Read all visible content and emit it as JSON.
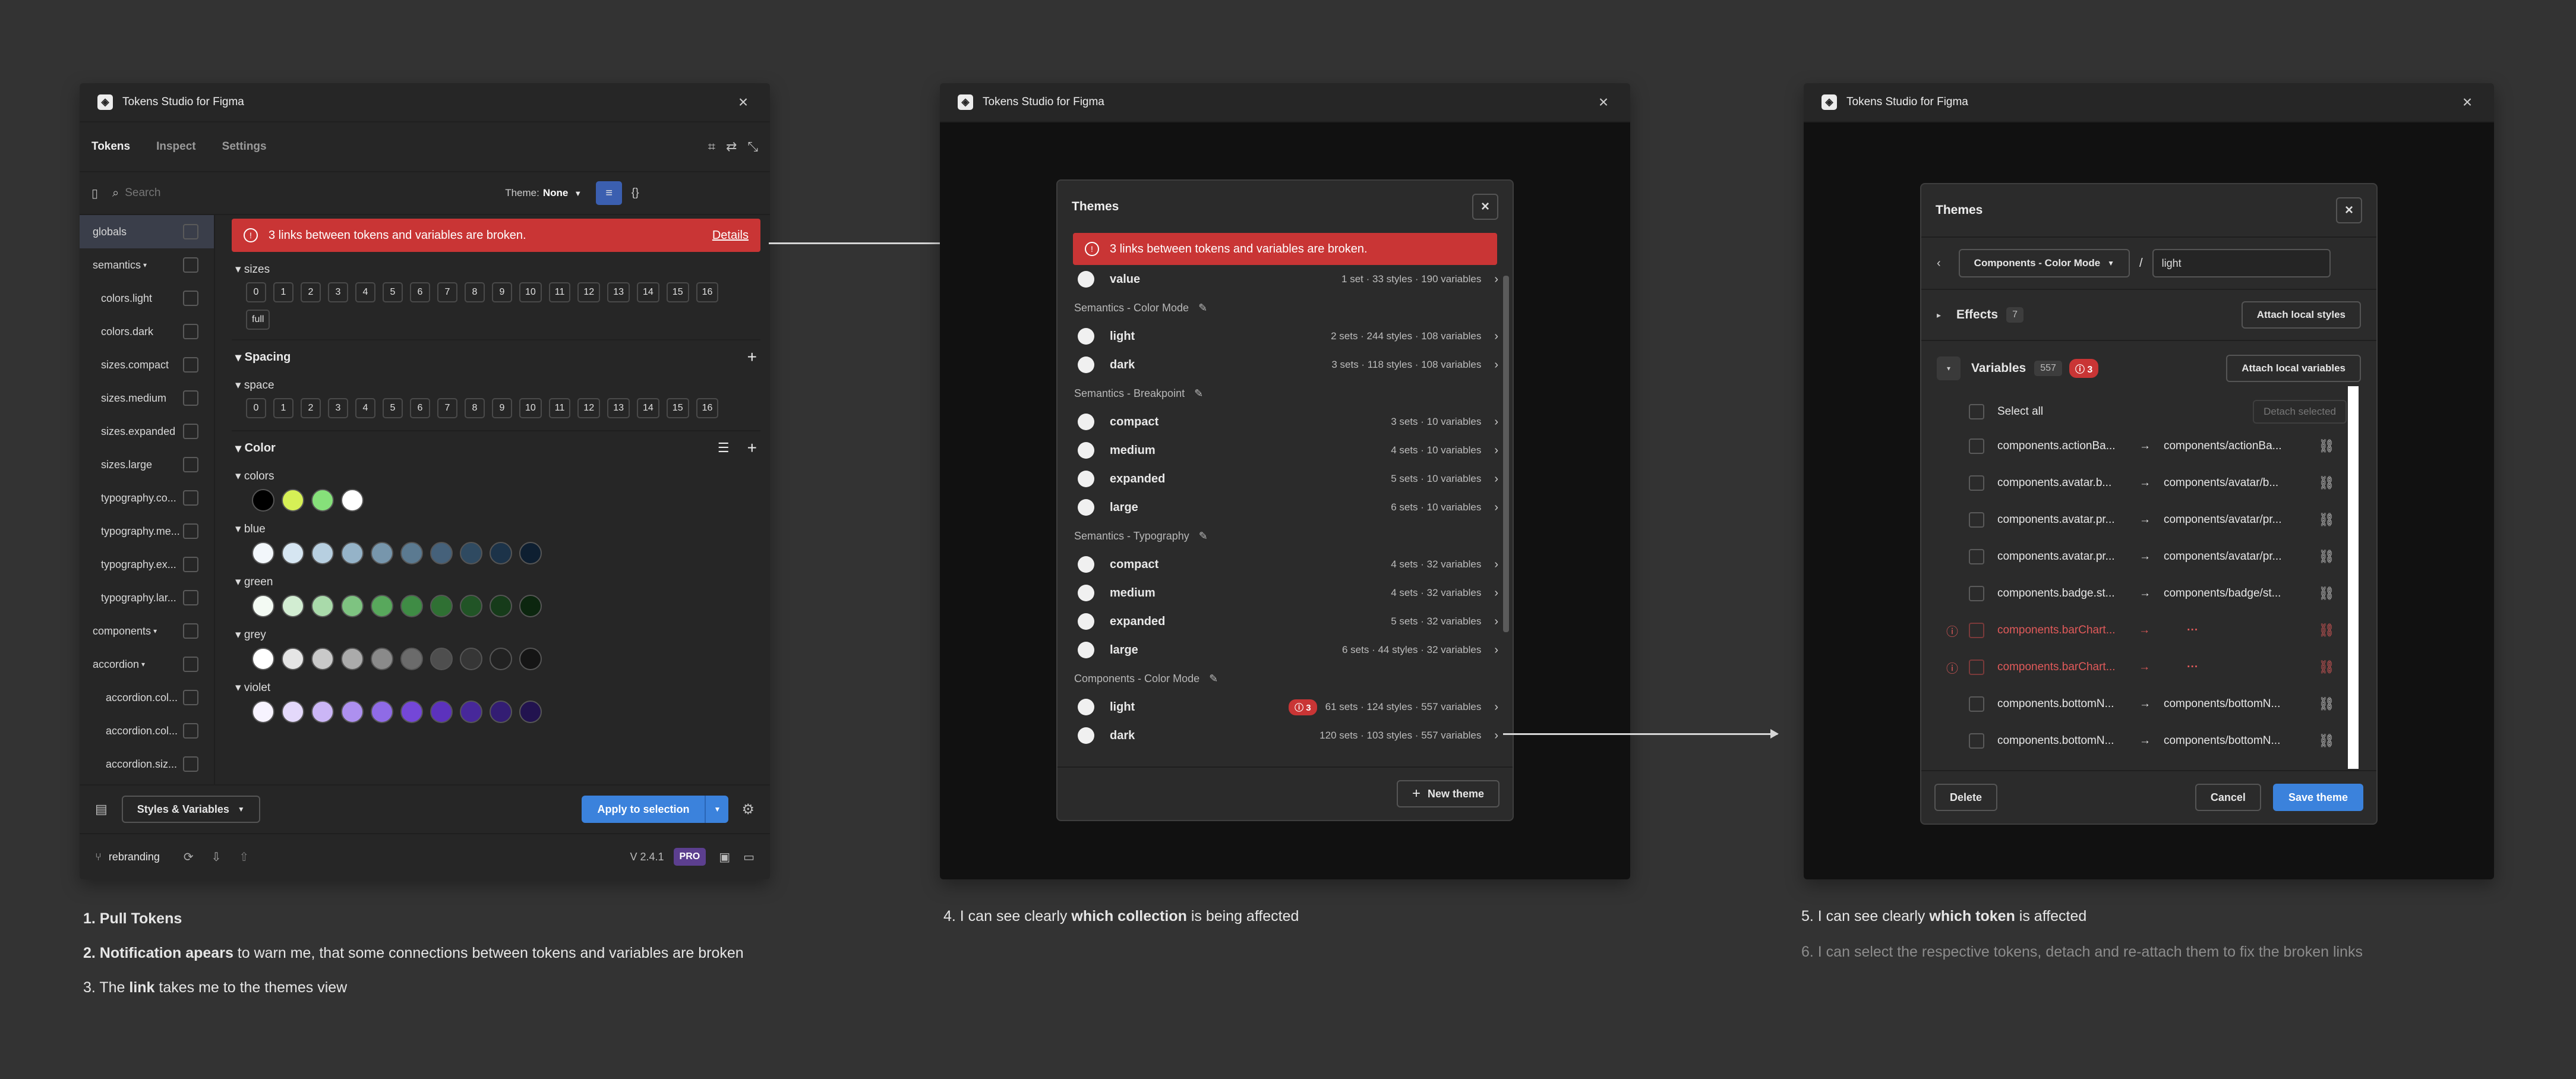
{
  "app_title": "Tokens Studio for Figma",
  "tabs": [
    "Tokens",
    "Inspect",
    "Settings"
  ],
  "search_placeholder": "Search",
  "theme_label": "Theme:",
  "theme_value": "None",
  "token_sets": [
    "globals",
    "semantics",
    "colors.light",
    "colors.dark",
    "sizes.compact",
    "sizes.medium",
    "sizes.expanded",
    "sizes.large",
    "typography.co...",
    "typography.me...",
    "typography.ex...",
    "typography.lar...",
    "components",
    "accordion",
    "accordion.col...",
    "accordion.col...",
    "accordion.siz..."
  ],
  "banner_text": "3 links between tokens and variables are broken.",
  "banner_link": "Details",
  "groups": {
    "sizes": "sizes",
    "spacing": "Spacing",
    "space": "space",
    "color": "Color",
    "colors": "colors",
    "blue": "blue",
    "green": "green",
    "grey": "grey",
    "violet": "violet"
  },
  "chips": [
    "0",
    "1",
    "2",
    "3",
    "4",
    "5",
    "6",
    "7",
    "8",
    "9",
    "10",
    "11",
    "12",
    "13",
    "14",
    "15",
    "16"
  ],
  "chip_full": "full",
  "swatches": {
    "colors": [
      "#000000",
      "#d6f056",
      "#86e07a",
      "#ffffff"
    ],
    "blue": [
      "#f2f7fb",
      "#d6e6f2",
      "#b7cfe0",
      "#95b3c8",
      "#7796ac",
      "#5b7a91",
      "#45617a",
      "#2f4a61",
      "#1c3349",
      "#0e1f31"
    ],
    "green": [
      "#f3faf3",
      "#d2edd2",
      "#a9daaa",
      "#7ec381",
      "#58a85c",
      "#3f8c45",
      "#2f7033",
      "#215426",
      "#163b1a",
      "#0c260f"
    ],
    "grey": [
      "#ffffff",
      "#e5e5e5",
      "#c9c9c9",
      "#ababab",
      "#8a8a8a",
      "#6b6b6b",
      "#4e4e4e",
      "#363636",
      "#222222",
      "#151515"
    ],
    "violet": [
      "#f7f3ff",
      "#e4d9fb",
      "#cbb6f6",
      "#ad90ef",
      "#8f6be6",
      "#7447d8",
      "#5c32bd",
      "#47289a",
      "#331d73",
      "#22134f"
    ]
  },
  "footer": {
    "styles_vars": "Styles & Variables",
    "apply": "Apply to selection",
    "branch": "rebranding",
    "version": "V 2.4.1",
    "pro": "PRO"
  },
  "themes_modal": {
    "title": "Themes",
    "banner": "3 links between tokens and variables are broken.",
    "rows": [
      {
        "kind": "item",
        "label": "value",
        "meta": "1 set · 33 styles · 190 variables"
      },
      {
        "kind": "section",
        "label": "Semantics - Color Mode"
      },
      {
        "kind": "item",
        "label": "light",
        "meta": "2 sets · 244 styles · 108 variables"
      },
      {
        "kind": "item",
        "label": "dark",
        "meta": "3 sets · 118 styles · 108 variables"
      },
      {
        "kind": "section",
        "label": "Semantics - Breakpoint"
      },
      {
        "kind": "item",
        "label": "compact",
        "meta": "3 sets · 10 variables"
      },
      {
        "kind": "item",
        "label": "medium",
        "meta": "4 sets · 10 variables"
      },
      {
        "kind": "item",
        "label": "expanded",
        "meta": "5 sets · 10 variables"
      },
      {
        "kind": "item",
        "label": "large",
        "meta": "6 sets · 10 variables"
      },
      {
        "kind": "section",
        "label": "Semantics - Typography"
      },
      {
        "kind": "item",
        "label": "compact",
        "meta": "4 sets · 32 variables"
      },
      {
        "kind": "item",
        "label": "medium",
        "meta": "4 sets · 32 variables"
      },
      {
        "kind": "item",
        "label": "expanded",
        "meta": "5 sets · 32 variables"
      },
      {
        "kind": "item",
        "label": "large",
        "meta": "6 sets · 44 styles · 32 variables"
      },
      {
        "kind": "section",
        "label": "Components - Color Mode"
      },
      {
        "kind": "item",
        "label": "light",
        "meta": "61 sets · 124 styles · 557 variables",
        "badge": "3"
      },
      {
        "kind": "item",
        "label": "dark",
        "meta": "120 sets · 103 styles · 557 variables"
      }
    ],
    "new_theme": "New theme"
  },
  "edit_modal": {
    "title": "Themes",
    "group": "Components - Color Mode",
    "slash": "/",
    "theme_name": "light",
    "effects_label": "Effects",
    "effects_count": "7",
    "attach_styles": "Attach local styles",
    "variables_label": "Variables",
    "variables_count": "557",
    "broken_count": "3",
    "attach_vars": "Attach local variables",
    "select_all": "Select all",
    "detach_selected": "Detach selected",
    "rows": [
      {
        "from": "components.actionBa...",
        "to": "components/actionBa...",
        "broken": false
      },
      {
        "from": "components.avatar.b...",
        "to": "components/avatar/b...",
        "broken": false
      },
      {
        "from": "components.avatar.pr...",
        "to": "components/avatar/pr...",
        "broken": false
      },
      {
        "from": "components.avatar.pr...",
        "to": "components/avatar/pr...",
        "broken": false
      },
      {
        "from": "components.badge.st...",
        "to": "components/badge/st...",
        "broken": false
      },
      {
        "from": "components.barChart...",
        "to": "···",
        "broken": true
      },
      {
        "from": "components.barChart...",
        "to": "···",
        "broken": true
      },
      {
        "from": "components.bottomN...",
        "to": "components/bottomN...",
        "broken": false
      },
      {
        "from": "components.bottomN...",
        "to": "components/bottomN...",
        "broken": false
      }
    ],
    "delete": "Delete",
    "cancel": "Cancel",
    "save": "Save theme"
  },
  "captions": {
    "c1": "1. Pull Tokens",
    "c2_bold": "2. Notification apears",
    "c2_rest": " to warn me, that some connections between tokens and variables are broken",
    "c3_pre": "3. The ",
    "c3_bold": "link",
    "c3_rest": " takes me to the themes view",
    "c4_pre": "4. I can see clearly ",
    "c4_bold": "which collection",
    "c4_rest": " is being affected",
    "c5_pre": "5. I can see clearly ",
    "c5_bold": "which token",
    "c5_rest": " is affected",
    "c6": "6. I can select the respective tokens, detach and re-attach them to fix the broken links"
  }
}
